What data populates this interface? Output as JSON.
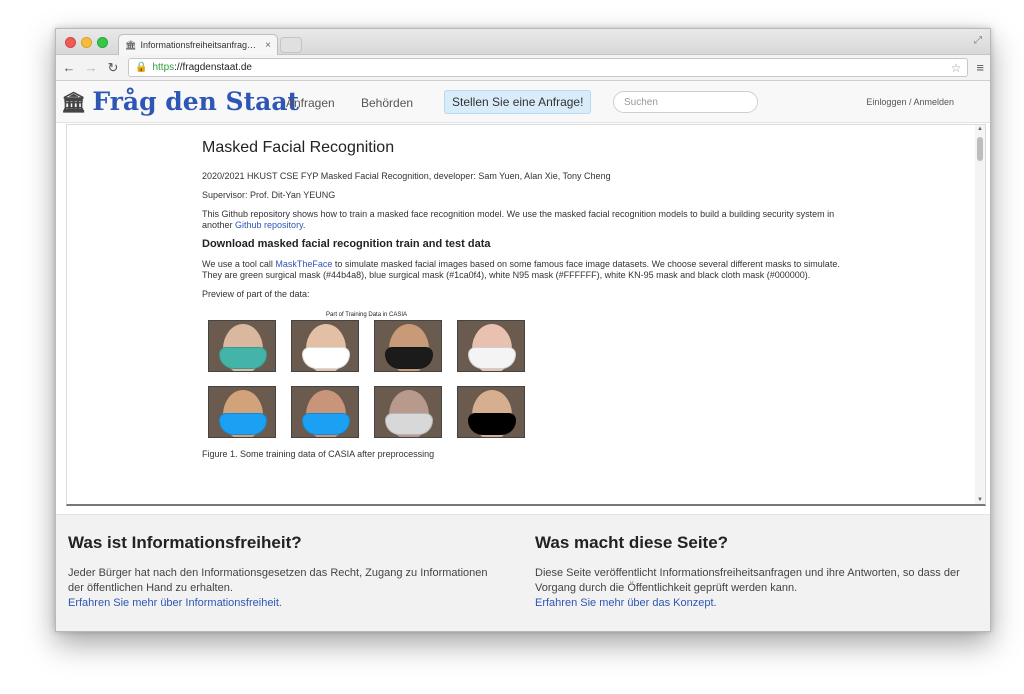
{
  "browser": {
    "tab_title": "Informationsfreiheitsanfrag…",
    "tab_close": "×",
    "url_scheme": "https",
    "url_rest": "://fragdenstaat.de"
  },
  "site": {
    "logo": "Fråg den Staat",
    "nav": [
      "Anfragen",
      "Behörden"
    ],
    "cta": "Stellen Sie eine Anfrage!",
    "search_placeholder": "Suchen",
    "login": "Einloggen / Anmelden"
  },
  "document": {
    "title": "Masked Facial Recognition",
    "meta": "2020/2021 HKUST CSE FYP Masked Facial Recognition, developer: Sam Yuen, Alan Xie, Tony Cheng",
    "supervisor": "Supervisor: Prof. Dit-Yan YEUNG",
    "intro_before": "This Github repository shows how to train a masked face recognition model. We use the masked facial recognition models to build a building security system in another ",
    "intro_link": "Github repository",
    "intro_after": ".",
    "section_title": "Download masked facial recognition train and test data",
    "tool_before": "We use a tool call ",
    "tool_link": "MaskTheFace",
    "tool_after": " to simulate masked facial images based on some famous face image datasets. We choose several different masks to simulate. They are green surgical mask (#44b4a8), blue surgical mask (#1ca0f4), white N95 mask (#FFFFFF), white KN-95 mask and black cloth mask (#000000).",
    "preview": "Preview of part of the data:",
    "figure_title": "Part of Training Data in CASIA",
    "caption": "Figure 1. Some training data of CASIA after preprocessing"
  },
  "figure_faces": [
    {
      "skin": "#d9b89f",
      "mask": "#44b4a8"
    },
    {
      "skin": "#e3c0a5",
      "mask": "#FFFFFF"
    },
    {
      "skin": "#c99a78",
      "mask": "#1b1b1b"
    },
    {
      "skin": "#e8c1b1",
      "mask": "#f4f4f4"
    },
    {
      "skin": "#d2a27a",
      "mask": "#1ca0f4"
    },
    {
      "skin": "#c8957a",
      "mask": "#1ca0f4"
    },
    {
      "skin": "#b89a8c",
      "mask": "#d8d8d8"
    },
    {
      "skin": "#d6ae90",
      "mask": "#000000"
    }
  ],
  "footer": {
    "left_title": "Was ist Informationsfreiheit?",
    "left_text": "Jeder Bürger hat nach den Informationsgesetzen das Recht, Zugang zu Informationen der öffentlichen Hand zu erhalten.",
    "left_link": "Erfahren Sie mehr über Informationsfreiheit.",
    "right_title": "Was macht diese Seite?",
    "right_text": "Diese Seite veröffentlicht Informationsfreiheitsanfragen und ihre Antworten, so dass der Vorgang durch die Öffentlichkeit geprüft werden kann.",
    "right_link": "Erfahren Sie mehr über das Konzept."
  }
}
